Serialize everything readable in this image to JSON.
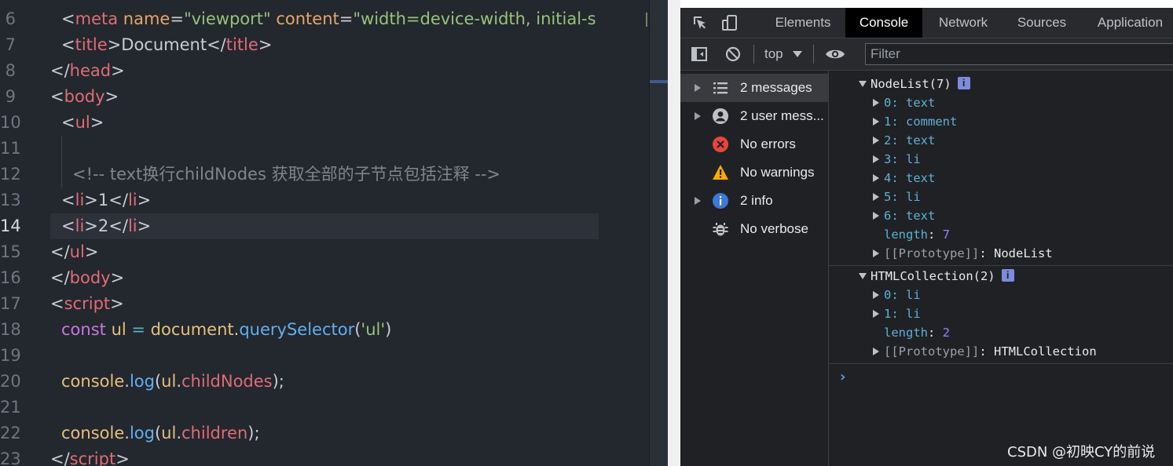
{
  "editor": {
    "lines": [
      {
        "num": "6",
        "tokens": [
          [
            "t-br",
            "<"
          ],
          [
            "t-tag",
            "meta "
          ],
          [
            "t-attr",
            "name"
          ],
          [
            "t-br",
            "="
          ],
          [
            "t-str",
            "\"viewport\" "
          ],
          [
            "t-attr",
            "content"
          ],
          [
            "t-br",
            "="
          ],
          [
            "t-str",
            "\"width=device-width, initial-s"
          ]
        ]
      },
      {
        "num": "7",
        "tokens": [
          [
            "t-br",
            "<"
          ],
          [
            "t-tag",
            "title"
          ],
          [
            "t-br",
            ">"
          ],
          [
            "t-text",
            "Document"
          ],
          [
            "t-br",
            "</"
          ],
          [
            "t-tag",
            "title"
          ],
          [
            "t-br",
            ">"
          ]
        ]
      },
      {
        "num": "8",
        "tokens": [
          [
            "t-br",
            "</"
          ],
          [
            "t-tag",
            "head"
          ],
          [
            "t-br",
            ">"
          ]
        ]
      },
      {
        "num": "9",
        "tokens": [
          [
            "t-br",
            "<"
          ],
          [
            "t-tag",
            "body"
          ],
          [
            "t-br",
            ">"
          ]
        ]
      },
      {
        "num": "10",
        "tokens": [
          [
            "t-br",
            "<"
          ],
          [
            "t-tag",
            "ul"
          ],
          [
            "t-br",
            ">"
          ]
        ]
      },
      {
        "num": "11",
        "tokens": []
      },
      {
        "num": "12",
        "tokens": [
          [
            "t-cmt",
            "<!-- text换行childNodes 获取全部的子节点包括注释 -->"
          ]
        ]
      },
      {
        "num": "13",
        "tokens": [
          [
            "t-br",
            "<"
          ],
          [
            "t-tag",
            "li"
          ],
          [
            "t-br",
            ">"
          ],
          [
            "t-text",
            "1"
          ],
          [
            "t-br",
            "</"
          ],
          [
            "t-tag",
            "li"
          ],
          [
            "t-br",
            ">"
          ]
        ]
      },
      {
        "num": "14",
        "tokens": [
          [
            "t-br",
            "<"
          ],
          [
            "t-tag",
            "li"
          ],
          [
            "t-br",
            ">"
          ],
          [
            "t-text",
            "2"
          ],
          [
            "t-br",
            "</"
          ],
          [
            "t-tag",
            "li"
          ],
          [
            "t-br",
            ">"
          ]
        ]
      },
      {
        "num": "15",
        "tokens": [
          [
            "t-br",
            "</"
          ],
          [
            "t-tag",
            "ul"
          ],
          [
            "t-br",
            ">"
          ]
        ]
      },
      {
        "num": "16",
        "tokens": [
          [
            "t-br",
            "</"
          ],
          [
            "t-tag",
            "body"
          ],
          [
            "t-br",
            ">"
          ]
        ]
      },
      {
        "num": "17",
        "tokens": [
          [
            "t-br",
            "<"
          ],
          [
            "t-tag",
            "script"
          ],
          [
            "t-br",
            ">"
          ]
        ]
      },
      {
        "num": "18",
        "tokens": [
          [
            "t-kw",
            "const "
          ],
          [
            "t-var",
            "ul "
          ],
          [
            "t-op",
            "= "
          ],
          [
            "t-var",
            "document"
          ],
          [
            "t-br",
            "."
          ],
          [
            "t-fn",
            "querySelector"
          ],
          [
            "t-br",
            "("
          ],
          [
            "t-str",
            "'ul'"
          ],
          [
            "t-br",
            ")"
          ]
        ]
      },
      {
        "num": "19",
        "tokens": []
      },
      {
        "num": "20",
        "tokens": [
          [
            "t-var",
            "console"
          ],
          [
            "t-br",
            "."
          ],
          [
            "t-fn",
            "log"
          ],
          [
            "t-br",
            "("
          ],
          [
            "t-var",
            "ul"
          ],
          [
            "t-br",
            "."
          ],
          [
            "t-prop",
            "childNodes"
          ],
          [
            "t-br",
            ");"
          ]
        ]
      },
      {
        "num": "21",
        "tokens": []
      },
      {
        "num": "22",
        "tokens": [
          [
            "t-var",
            "console"
          ],
          [
            "t-br",
            "."
          ],
          [
            "t-fn",
            "log"
          ],
          [
            "t-br",
            "("
          ],
          [
            "t-var",
            "ul"
          ],
          [
            "t-br",
            "."
          ],
          [
            "t-prop",
            "children"
          ],
          [
            "t-br",
            ");"
          ]
        ]
      },
      {
        "num": "23",
        "tokens": [
          [
            "t-br",
            "</"
          ],
          [
            "t-tag",
            "script"
          ],
          [
            "t-br",
            ">"
          ]
        ]
      }
    ],
    "active_line": "14"
  },
  "devtools": {
    "tabs": [
      "Elements",
      "Console",
      "Network",
      "Sources",
      "Application"
    ],
    "active_tab": "Console",
    "context": "top",
    "filter_placeholder": "Filter",
    "sidebar": [
      {
        "label": "2 messages",
        "icon": "list-icon",
        "expandable": true,
        "selected": true
      },
      {
        "label": "2 user mess...",
        "icon": "user-icon",
        "expandable": true,
        "selected": false
      },
      {
        "label": "No errors",
        "icon": "error-icon",
        "expandable": false,
        "selected": false
      },
      {
        "label": "No warnings",
        "icon": "warning-icon",
        "expandable": false,
        "selected": false
      },
      {
        "label": "2 info",
        "icon": "info-icon",
        "expandable": true,
        "selected": false
      },
      {
        "label": "No verbose",
        "icon": "bug-icon",
        "expandable": false,
        "selected": false
      }
    ],
    "nodelist": {
      "header": "NodeList(7)",
      "items": [
        {
          "key": "0",
          "value": "text"
        },
        {
          "key": "1",
          "value": "comment"
        },
        {
          "key": "2",
          "value": "text"
        },
        {
          "key": "3",
          "value": "li"
        },
        {
          "key": "4",
          "value": "text"
        },
        {
          "key": "5",
          "value": "li"
        },
        {
          "key": "6",
          "value": "text"
        }
      ],
      "length_label": "length",
      "length": "7",
      "proto_label": "[[Prototype]]",
      "proto": "NodeList"
    },
    "htmlcollection": {
      "header": "HTMLCollection(2)",
      "items": [
        {
          "key": "0",
          "value": "li"
        },
        {
          "key": "1",
          "value": "li"
        }
      ],
      "length_label": "length",
      "length": "2",
      "proto_label": "[[Prototype]]",
      "proto": "HTMLCollection"
    },
    "prompt": "›"
  },
  "watermark": "CSDN @初映CY的前说",
  "colors": {
    "editor_bg": "#23272e",
    "devtools_bg": "#202124",
    "accent_blue": "#4e9ee8",
    "error_red": "#e8453c",
    "warning_yellow": "#f9ab00",
    "info_blue": "#3c7ad8"
  }
}
